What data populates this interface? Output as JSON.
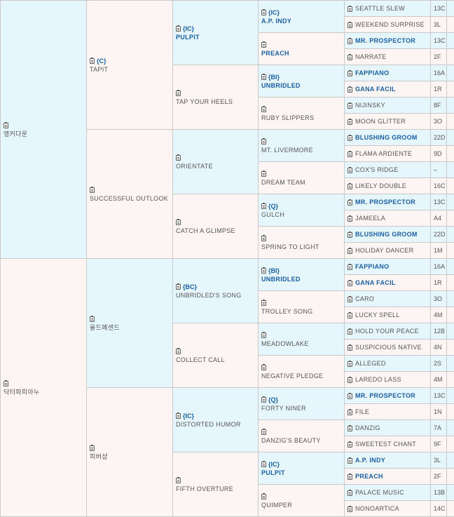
{
  "root": [
    {
      "name": "앵커다운",
      "color": "blue"
    },
    {
      "name": "닥터파피아누",
      "color": "pink"
    }
  ],
  "gen1": [
    {
      "name": "TAPIT",
      "code": "{C}",
      "color": "pink"
    },
    {
      "name": "SUCCESSFUL OUTLOOK",
      "code": "",
      "color": "pink"
    },
    {
      "name": "올드페센드",
      "code": "",
      "color": "blue"
    },
    {
      "name": "피버샵",
      "code": "",
      "color": "pink"
    }
  ],
  "gen2": [
    {
      "name": "PULPIT",
      "code": "{IC}",
      "bold": true,
      "color": "blue"
    },
    {
      "name": "TAP YOUR HEELS",
      "code": "",
      "bold": false,
      "color": "pink"
    },
    {
      "name": "ORIENTATE",
      "code": "",
      "bold": false,
      "color": "blue"
    },
    {
      "name": "CATCH A GLIMPSE",
      "code": "",
      "bold": false,
      "color": "pink"
    },
    {
      "name": "UNBRIDLED'S SONG",
      "code": "{BC}",
      "bold": false,
      "color": "blue"
    },
    {
      "name": "COLLECT CALL",
      "code": "",
      "bold": false,
      "color": "pink"
    },
    {
      "name": "DISTORTED HUMOR",
      "code": "{IC}",
      "bold": false,
      "color": "blue"
    },
    {
      "name": "FIFTH OVERTURE",
      "code": "",
      "bold": false,
      "color": "pink"
    }
  ],
  "gen3": [
    {
      "name": "A.P. INDY",
      "code": "{IC}",
      "bold": true,
      "color": "blue"
    },
    {
      "name": "PREACH",
      "code": "",
      "bold": true,
      "color": "pink"
    },
    {
      "name": "UNBRIDLED",
      "code": "{BI}",
      "bold": true,
      "color": "blue"
    },
    {
      "name": "RUBY SLIPPERS",
      "code": "",
      "bold": false,
      "color": "pink"
    },
    {
      "name": "MT. LIVERMORE",
      "code": "",
      "bold": false,
      "color": "blue"
    },
    {
      "name": "DREAM TEAM",
      "code": "",
      "bold": false,
      "color": "pink"
    },
    {
      "name": "GULCH",
      "code": "{Q}",
      "bold": false,
      "color": "blue"
    },
    {
      "name": "SPRING TO LIGHT",
      "code": "",
      "bold": false,
      "color": "pink"
    },
    {
      "name": "UNBRIDLED",
      "code": "{BI}",
      "bold": true,
      "color": "blue"
    },
    {
      "name": "TROLLEY SONG",
      "code": "",
      "bold": false,
      "color": "pink"
    },
    {
      "name": "MEADOWLAKE",
      "code": "",
      "bold": false,
      "color": "blue"
    },
    {
      "name": "NEGATIVE PLEDGE",
      "code": "",
      "bold": false,
      "color": "pink"
    },
    {
      "name": "FORTY NINER",
      "code": "{Q}",
      "bold": false,
      "color": "blue"
    },
    {
      "name": "DANZIG'S BEAUTY",
      "code": "",
      "bold": false,
      "color": "pink"
    },
    {
      "name": "PULPIT",
      "code": "{IC}",
      "bold": true,
      "color": "blue"
    },
    {
      "name": "QUIMPER",
      "code": "",
      "bold": false,
      "color": "pink"
    }
  ],
  "gen4": [
    {
      "name": "SEATTLE SLEW",
      "num": "13C",
      "bold": false,
      "color": "blue"
    },
    {
      "name": "WEEKEND SURPRISE",
      "num": "3L",
      "bold": false,
      "color": "pink"
    },
    {
      "name": "MR. PROSPECTOR",
      "num": "13C",
      "bold": true,
      "color": "blue"
    },
    {
      "name": "NARRATE",
      "num": "2F",
      "bold": false,
      "color": "pink"
    },
    {
      "name": "FAPPIANO",
      "num": "16A",
      "bold": true,
      "color": "blue"
    },
    {
      "name": "GANA FACIL",
      "num": "1R",
      "bold": true,
      "color": "pink"
    },
    {
      "name": "NIJINSKY",
      "num": "8F",
      "bold": false,
      "color": "blue"
    },
    {
      "name": "MOON GLITTER",
      "num": "3O",
      "bold": false,
      "color": "pink"
    },
    {
      "name": "BLUSHING GROOM",
      "num": "22D",
      "bold": true,
      "color": "blue"
    },
    {
      "name": "FLAMA ARDIENTE",
      "num": "9D",
      "bold": false,
      "color": "pink"
    },
    {
      "name": "COX'S RIDGE",
      "num": "–",
      "bold": false,
      "color": "blue"
    },
    {
      "name": "LIKELY DOUBLE",
      "num": "16C",
      "bold": false,
      "color": "pink"
    },
    {
      "name": "MR. PROSPECTOR",
      "num": "13C",
      "bold": true,
      "color": "blue"
    },
    {
      "name": "JAMEELA",
      "num": "A4",
      "bold": false,
      "color": "pink"
    },
    {
      "name": "BLUSHING GROOM",
      "num": "22D",
      "bold": true,
      "color": "blue"
    },
    {
      "name": "HOLIDAY DANCER",
      "num": "1M",
      "bold": false,
      "color": "pink"
    },
    {
      "name": "FAPPIANO",
      "num": "16A",
      "bold": true,
      "color": "blue"
    },
    {
      "name": "GANA FACIL",
      "num": "1R",
      "bold": true,
      "color": "pink"
    },
    {
      "name": "CARO",
      "num": "3O",
      "bold": false,
      "color": "blue"
    },
    {
      "name": "LUCKY SPELL",
      "num": "4M",
      "bold": false,
      "color": "pink"
    },
    {
      "name": "HOLD YOUR PEACE",
      "num": "12B",
      "bold": false,
      "color": "blue"
    },
    {
      "name": "SUSPICIOUS NATIVE",
      "num": "4N",
      "bold": false,
      "color": "pink"
    },
    {
      "name": "ALLEGED",
      "num": "2S",
      "bold": false,
      "color": "blue"
    },
    {
      "name": "LAREDO LASS",
      "num": "4M",
      "bold": false,
      "color": "pink"
    },
    {
      "name": "MR. PROSPECTOR",
      "num": "13C",
      "bold": true,
      "color": "blue"
    },
    {
      "name": "FILE",
      "num": "1N",
      "bold": false,
      "color": "pink"
    },
    {
      "name": "DANZIG",
      "num": "7A",
      "bold": false,
      "color": "blue"
    },
    {
      "name": "SWEETEST CHANT",
      "num": "9F",
      "bold": false,
      "color": "pink"
    },
    {
      "name": "A.P. INDY",
      "num": "3L",
      "bold": true,
      "color": "blue"
    },
    {
      "name": "PREACH",
      "num": "2F",
      "bold": true,
      "color": "pink"
    },
    {
      "name": "PALACE MUSIC",
      "num": "13B",
      "bold": false,
      "color": "blue"
    },
    {
      "name": "NONOARTICA",
      "num": "14C",
      "bold": false,
      "color": "pink"
    }
  ]
}
